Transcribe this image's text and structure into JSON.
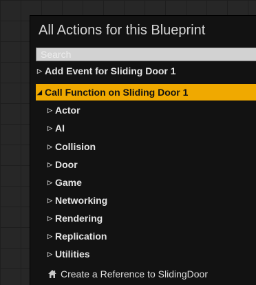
{
  "panel": {
    "title": "All Actions for this Blueprint"
  },
  "search": {
    "placeholder": "Search",
    "value": ""
  },
  "tree": {
    "add_event": {
      "arrow": "▷",
      "label": "Add Event for Sliding Door 1"
    },
    "call_function": {
      "arrow": "◢",
      "label": "Call Function on Sliding Door 1",
      "selected_color": "#f0a900"
    },
    "children": [
      {
        "arrow": "▷",
        "label": "Actor"
      },
      {
        "arrow": "▷",
        "label": "AI"
      },
      {
        "arrow": "▷",
        "label": "Collision"
      },
      {
        "arrow": "▷",
        "label": "Door"
      },
      {
        "arrow": "▷",
        "label": "Game"
      },
      {
        "arrow": "▷",
        "label": "Networking"
      },
      {
        "arrow": "▷",
        "label": "Rendering"
      },
      {
        "arrow": "▷",
        "label": "Replication"
      },
      {
        "arrow": "▷",
        "label": "Utilities"
      }
    ],
    "reference_action": {
      "icon": "house-icon",
      "label": "Create a Reference to SlidingDoor"
    }
  }
}
